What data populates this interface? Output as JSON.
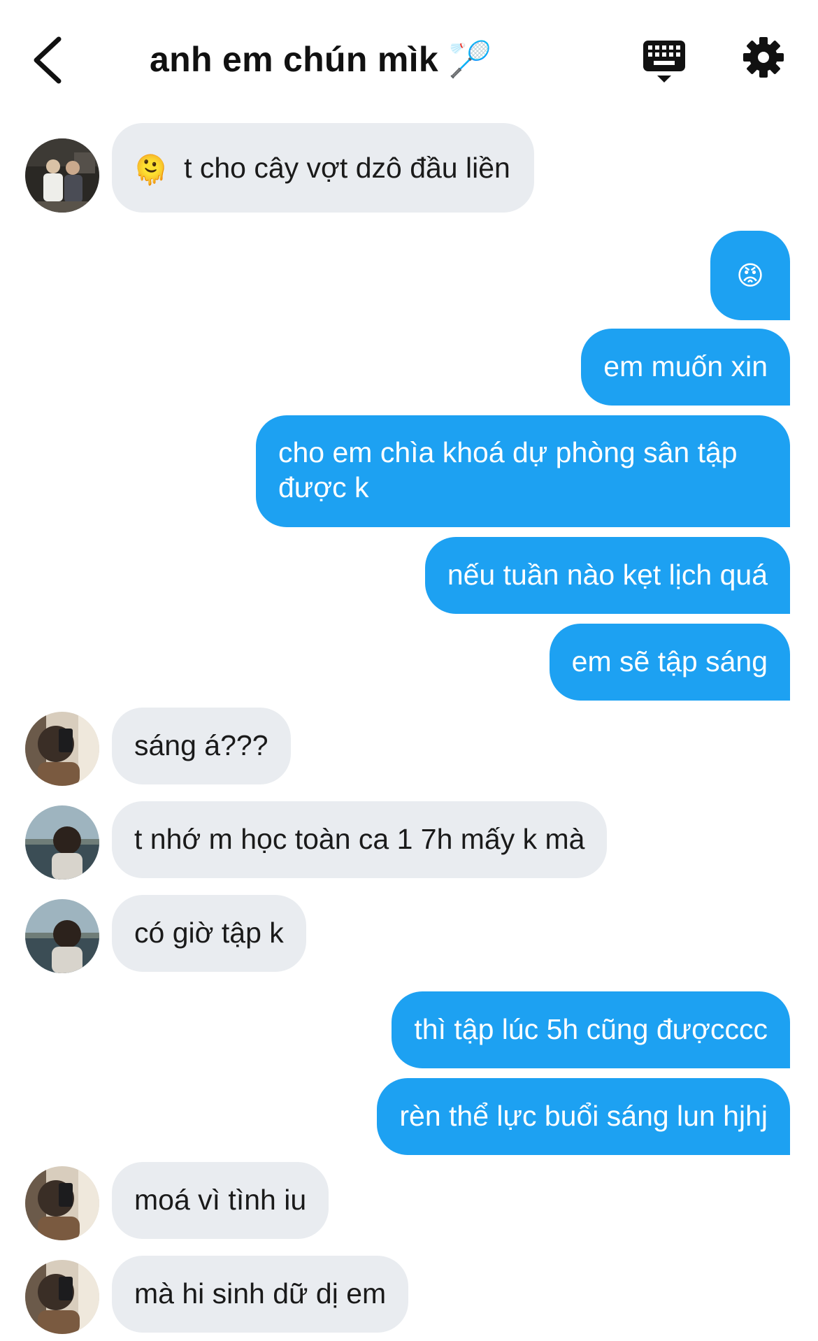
{
  "header": {
    "title": "anh em chún mìk",
    "title_emoji": "🏸",
    "icons": [
      "back-chevron-icon",
      "keyboard-icon",
      "gear-icon"
    ]
  },
  "messages": [
    {
      "side": "in",
      "text": "t cho cây vợt dzô đầu liền",
      "emoji": "🫠"
    },
    {
      "side": "out",
      "emoji": "😡",
      "text": ""
    },
    {
      "side": "out",
      "text": "em muốn xin"
    },
    {
      "side": "out",
      "text": "cho em chìa khoá dự phòng sân tập được k"
    },
    {
      "side": "out",
      "text": "nếu tuần nào kẹt lịch quá"
    },
    {
      "side": "out",
      "text": "em sẽ tập sáng"
    },
    {
      "side": "in",
      "text": "sáng á???"
    },
    {
      "side": "in",
      "text": "t nhớ m học toàn ca 1 7h mấy k mà"
    },
    {
      "side": "in",
      "text": "có giờ tập k"
    },
    {
      "side": "out",
      "text": "thì tập lúc 5h cũng đượcccc"
    },
    {
      "side": "out",
      "text": "rèn thể lực buổi sáng lun hjhj"
    },
    {
      "side": "in",
      "text": "moá vì tình iu"
    },
    {
      "side": "in",
      "text": "mà hi sinh dữ dị em"
    }
  ],
  "colors": {
    "outgoing_bubble": "#1da1f2",
    "incoming_bubble": "#e9ecf0",
    "background": "#ffffff"
  }
}
